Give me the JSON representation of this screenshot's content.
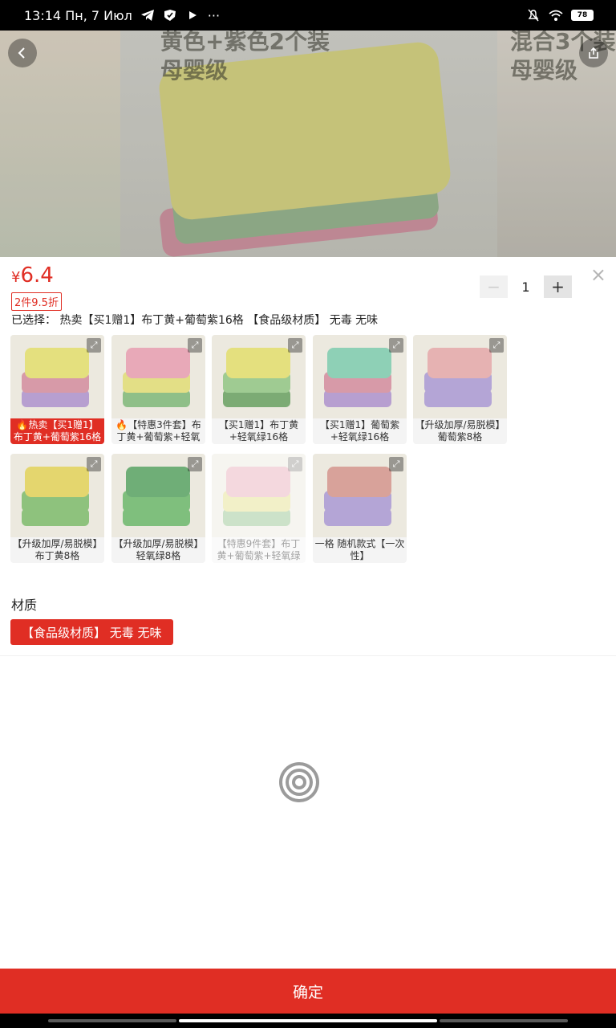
{
  "status_bar": {
    "time_date": "13:14 Пн, 7 Июл",
    "ellipsis": "···",
    "battery": "78"
  },
  "hero": {
    "text_main": "黄色+紫色2个装",
    "text_sub": "母婴级",
    "text_right": "混合3个装",
    "back_icon": "back-icon",
    "share_icon": "share-icon"
  },
  "sheet": {
    "price_symbol": "¥",
    "price": "6.4",
    "discount": "2件9.5折",
    "quantity": "1",
    "minus": "−",
    "plus": "+",
    "close": "×",
    "selected": "已选择： 热卖【买1赠1】布丁黄+葡萄紫16格 【食品级材质】 无毒 无味"
  },
  "variants": [
    {
      "label": "🔥热卖【买1赠1】布丁黄+葡萄紫16格",
      "state": "selected",
      "top": "#e4e07e",
      "mid": "#d79aa8",
      "bot": "#b79fd0"
    },
    {
      "label": "🔥【特惠3件套】布丁黄+葡萄紫+轻氧绿",
      "state": "normal",
      "top": "#e8a9b8",
      "mid": "#e3df86",
      "bot": "#8fbf88"
    },
    {
      "label": "【买1赠1】布丁黄+轻氧绿16格",
      "state": "normal",
      "top": "#e4e07e",
      "mid": "#9fcb92",
      "bot": "#7cab74"
    },
    {
      "label": "【买1赠1】葡萄紫+轻氧绿16格",
      "state": "normal",
      "top": "#8ed0b6",
      "mid": "#d79aa8",
      "bot": "#b79fd0"
    },
    {
      "label": "【升级加厚/易脱模】葡萄紫8格",
      "state": "normal",
      "top": "#e6b2b2",
      "mid": "#b4a5d6",
      "bot": "#b4a5d6"
    },
    {
      "label": "【升级加厚/易脱模】布丁黄8格",
      "state": "normal",
      "top": "#e4d66e",
      "mid": "#8ec27d",
      "bot": "#8ec27d"
    },
    {
      "label": "【升级加厚/易脱模】轻氧绿8格",
      "state": "normal",
      "top": "#6fae77",
      "mid": "#7fbf7d",
      "bot": "#7fbf7d"
    },
    {
      "label": "【特惠9件套】布丁黄+葡萄紫+轻氧绿",
      "state": "disabled",
      "top": "#e8a9b8",
      "mid": "#e3df86",
      "bot": "#8fbf88"
    },
    {
      "label": "一格 随机款式【一次性】",
      "state": "normal",
      "top": "#d8a29a",
      "mid": "#b4a5d6",
      "bot": "#b4a5d6"
    }
  ],
  "material": {
    "title": "材质",
    "option": "【食品级材质】 无毒 无味"
  },
  "confirm_label": "确定",
  "colors": {
    "accent": "#e02e24"
  }
}
